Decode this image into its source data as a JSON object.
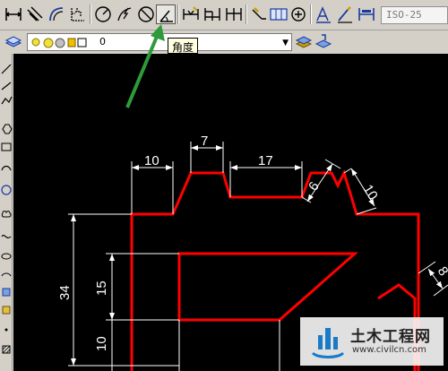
{
  "toolbar": {
    "dim_style": "ISO-25",
    "buttons": [
      {
        "name": "linear-dimension-icon"
      },
      {
        "name": "aligned-dimension-icon"
      },
      {
        "name": "arc-length-icon"
      },
      {
        "name": "ordinate-dimension-icon"
      },
      {
        "name": "radius-dimension-icon"
      },
      {
        "name": "jogged-dimension-icon"
      },
      {
        "name": "diameter-dimension-icon"
      },
      {
        "name": "angular-dimension-icon",
        "pressed": true
      },
      {
        "name": "quick-dimension-icon"
      },
      {
        "name": "baseline-dimension-icon"
      },
      {
        "name": "continue-dimension-icon"
      },
      {
        "name": "quick-leader-icon"
      },
      {
        "name": "tolerance-icon"
      },
      {
        "name": "center-mark-icon"
      },
      {
        "name": "dimension-edit-icon"
      },
      {
        "name": "dimension-text-edit-icon"
      },
      {
        "name": "dimension-update-icon"
      }
    ]
  },
  "layer_toolbar": {
    "current_layer": "0"
  },
  "tooltip": {
    "text": "角度"
  },
  "drawing": {
    "dimensions": [
      "10",
      "7",
      "17",
      "6",
      "10",
      "34",
      "15",
      "10",
      "8"
    ],
    "colors": {
      "outline": "#ff0000",
      "dimension": "#ffffff",
      "background": "#000000",
      "arrow": "#2e9a3a"
    }
  },
  "watermark": {
    "name": "土木工程网",
    "url": "www.civilcn.com"
  }
}
